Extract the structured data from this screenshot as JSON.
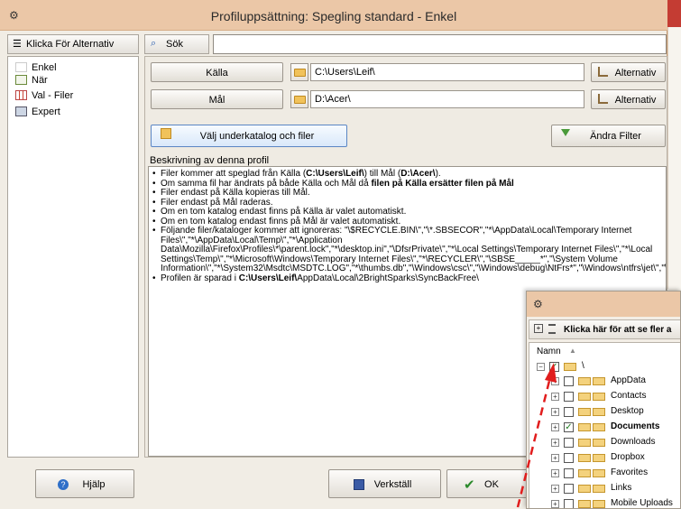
{
  "window": {
    "title": "Profiluppsättning: Spegling standard - Enkel"
  },
  "sidebar": {
    "header": "Klicka För Alternativ",
    "items": [
      {
        "label": "Enkel"
      },
      {
        "label": "När"
      },
      {
        "label": "Val - Filer"
      },
      {
        "label": "Expert"
      }
    ]
  },
  "search": {
    "label": "Sök",
    "value": ""
  },
  "source": {
    "label": "Källa",
    "path": "C:\\Users\\Leif\\",
    "options_label": "Alternativ"
  },
  "destination": {
    "label": "Mål",
    "path": "D:\\Acer\\",
    "options_label": "Alternativ"
  },
  "subdir_button": "Välj underkatalog och filer",
  "filter_button": "Ändra Filter",
  "description": {
    "title": "Beskrivning av denna profil",
    "lines": [
      [
        "Filer kommer att speglad från Källa (",
        "C:\\Users\\Leif\\",
        ") till Mål (",
        "D:\\Acer\\",
        ")."
      ],
      [
        "Om samma fil har ändrats på både Källa och Mål då ",
        "filen på Källa ersätter filen på Mål",
        "",
        "",
        ""
      ],
      [
        "Filer endast på Källa kopieras till Mål.",
        "",
        "",
        "",
        ""
      ],
      [
        "Filer endast på Mål raderas.",
        "",
        "",
        "",
        ""
      ],
      [
        "Om en tom katalog endast finns på Källa är valet automatiskt.",
        "",
        "",
        "",
        ""
      ],
      [
        "Om en tom katalog endast finns på Mål är valet automatiskt.",
        "",
        "",
        "",
        ""
      ],
      [
        "Följande filer/kataloger kommer att ignoreras: \"\\$RECYCLE.BIN\\\",\"\\*.SBSECOR\",\"*\\AppData\\Local\\Temporary Internet Files\\\",\"*\\AppData\\Local\\Temp\\\",\"*\\Application Data\\Mozilla\\Firefox\\Profiles\\*\\parent.lock\",\"*\\desktop.ini\",\"\\DfsrPrivate\\\",\"*\\Local Settings\\Temporary Internet Files\\\",\"*\\Local Settings\\Temp\\\",\"*\\Microsoft\\Windows\\Temporary Internet Files\\\",\"*\\RECYCLER\\\",\"\\SBSE_____*\",\"\\System Volume Information\\\",\"*\\System32\\Msdtc\\MSDTC.LOG\",\"*\\thumbs.db\",\"\\Windows\\csc\\\",\"\\Windows\\debug\\NtFrs*\",\"\\Windows\\ntfrs\\jet\\\",\"\\Windows\\Prefetch\\\",\"\\Windows\\Registration\\*.crmlog\",\"\\Windows\\sysvol\\domain\\DO_NOT_REMOVE_NtFrs_PreInstall_Directory\\\",\"\\Windows\\sysvol\\domain\\NtFrs_PreExi\\sysvol\\staging\\domain\\NTFRS_*\",\"\\Windows\\Temp\\\",\\hiberfil.sys\\,\\pagefile.sys\\,\\PGPWD",
        "",
        "",
        "",
        ""
      ],
      [
        "Profilen är sparad i ",
        "C:\\Users\\Leif\\",
        "AppData\\Local\\2BrightSparks\\SyncBackFree\\",
        "",
        ""
      ]
    ]
  },
  "buttons": {
    "help": "Hjälp",
    "apply": "Verkställ",
    "ok": "OK"
  },
  "tree": {
    "hint": "Klicka här för att se fler a",
    "column": "Namn",
    "root": "\\",
    "nodes": [
      {
        "label": "AppData",
        "checked": false
      },
      {
        "label": "Contacts",
        "checked": false
      },
      {
        "label": "Desktop",
        "checked": false
      },
      {
        "label": "Documents",
        "checked": true
      },
      {
        "label": "Downloads",
        "checked": false
      },
      {
        "label": "Dropbox",
        "checked": false
      },
      {
        "label": "Favorites",
        "checked": false
      },
      {
        "label": "Links",
        "checked": false
      },
      {
        "label": "Mobile Uploads",
        "checked": false
      }
    ]
  },
  "colors": {
    "titlebar": "#ebc7a7",
    "accent_red": "#e11d1d",
    "check_green": "#1d7a1d"
  }
}
